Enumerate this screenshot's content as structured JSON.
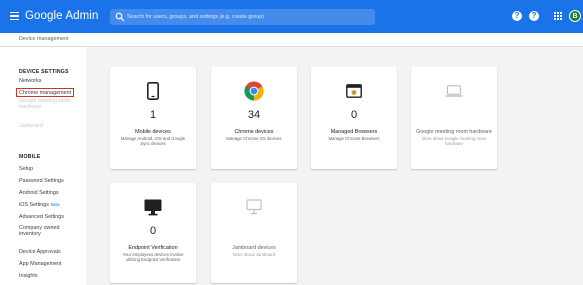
{
  "header": {
    "app_title": "Google Admin",
    "search_placeholder": "Search for users, groups, and settings (e.g. create group)",
    "avatar_letter": "B",
    "colors": {
      "bar": "#1a73e8",
      "avatar": "#188038"
    }
  },
  "breadcrumb": "Device management",
  "sidebar": {
    "device_settings_title": "DEVICE SETTINGS",
    "device_items": [
      {
        "label": "Networks",
        "state": "normal"
      },
      {
        "label": "Chrome management",
        "state": "highlighted"
      },
      {
        "label": "Google meeting room hardware",
        "state": "disabled"
      },
      {
        "label": "Jamboard",
        "state": "disabled"
      }
    ],
    "mobile_title": "MOBILE",
    "mobile_items": [
      {
        "label": "Setup"
      },
      {
        "label": "Password Settings"
      },
      {
        "label": "Android Settings"
      },
      {
        "label": "iOS Settings",
        "badge": "Beta"
      },
      {
        "label": "Advanced Settings"
      },
      {
        "label": "Company owned inventory"
      },
      {
        "label": "Device Approvals"
      },
      {
        "label": "App Management"
      },
      {
        "label": "Insights"
      }
    ]
  },
  "cards": [
    {
      "icon": "mobile-phone-icon",
      "count": "1",
      "title": "Mobile devices",
      "desc": "Manage Android, iOS and Google Sync devices"
    },
    {
      "icon": "chrome-logo-icon",
      "count": "34",
      "title": "Chrome devices",
      "desc": "Manage Chrome OS devices"
    },
    {
      "icon": "browser-window-icon",
      "count": "0",
      "title": "Managed Browsers",
      "desc": "Manage Chrome Browsers"
    },
    {
      "icon": "laptop-icon",
      "count": "",
      "title": "Google meeting room hardware",
      "desc": "More about Google meeting room hardware"
    },
    {
      "icon": "desktop-monitor-icon",
      "count": "0",
      "title": "Endpoint Verification",
      "desc": "Your employees devices involve utilizing Endpoint Verification"
    },
    {
      "icon": "jamboard-display-icon",
      "count": "",
      "title": "Jamboard devices",
      "desc": "More about Jamboard"
    }
  ]
}
